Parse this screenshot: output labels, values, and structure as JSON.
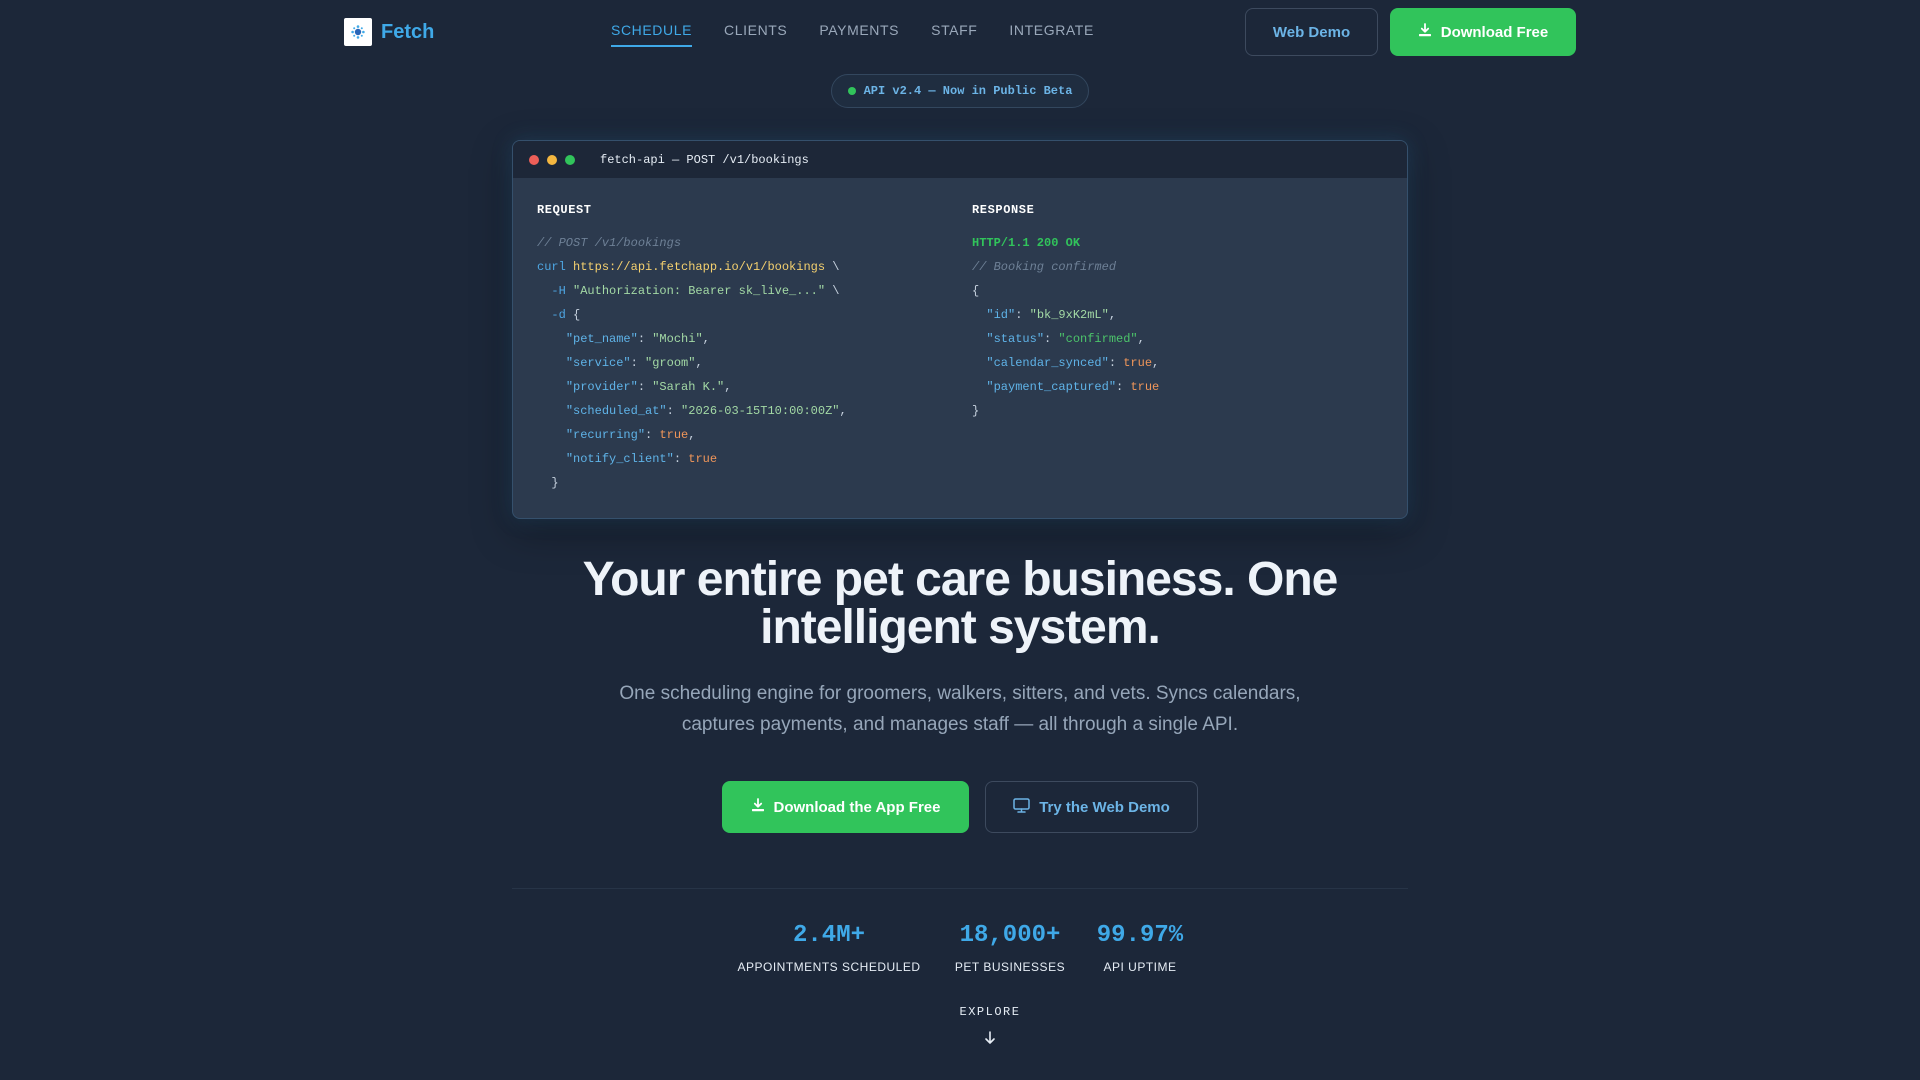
{
  "brand": {
    "name": "Fetch"
  },
  "nav": {
    "links": [
      {
        "label": "SCHEDULE",
        "active": true
      },
      {
        "label": "CLIENTS",
        "active": false
      },
      {
        "label": "PAYMENTS",
        "active": false
      },
      {
        "label": "STAFF",
        "active": false
      },
      {
        "label": "INTEGRATE",
        "active": false
      }
    ],
    "web_demo_label": "Web Demo",
    "download_label": "Download Free"
  },
  "badge": {
    "text": "API v2.4 — Now in Public Beta"
  },
  "terminal": {
    "title": "fetch-api — POST /v1/bookings",
    "request": {
      "heading": "REQUEST",
      "comment": "// POST /v1/bookings",
      "curl_cmd": "curl",
      "url": "https://api.fetchapp.io/v1/bookings",
      "header_flag": "-H",
      "header_value": "\"Authorization: Bearer sk_live_...\"",
      "data_flag": "-d",
      "fields": [
        {
          "key": "\"pet_name\"",
          "value": "\"Mochi\"",
          "type": "string"
        },
        {
          "key": "\"service\"",
          "value": "\"groom\"",
          "type": "string"
        },
        {
          "key": "\"provider\"",
          "value": "\"Sarah K.\"",
          "type": "string"
        },
        {
          "key": "\"scheduled_at\"",
          "value": "\"2026-03-15T10:00:00Z\"",
          "type": "string"
        },
        {
          "key": "\"recurring\"",
          "value": "true",
          "type": "bool"
        },
        {
          "key": "\"notify_client\"",
          "value": "true",
          "type": "bool"
        }
      ]
    },
    "response": {
      "heading": "RESPONSE",
      "status_line": "HTTP/1.1 200 OK",
      "comment": "// Booking confirmed",
      "fields": [
        {
          "key": "\"id\"",
          "value": "\"bk_9xK2mL\"",
          "type": "string"
        },
        {
          "key": "\"status\"",
          "value": "\"confirmed\"",
          "type": "status"
        },
        {
          "key": "\"calendar_synced\"",
          "value": "true",
          "type": "bool"
        },
        {
          "key": "\"payment_captured\"",
          "value": "true",
          "type": "bool"
        }
      ]
    }
  },
  "hero": {
    "title": "Your entire pet care business. One intelligent system.",
    "subtitle": "One scheduling engine for groomers, walkers, sitters, and vets. Syncs calendars, captures payments, and manages staff — all through a single API.",
    "cta_download": "Download the App Free",
    "cta_demo": "Try the Web Demo"
  },
  "stats": [
    {
      "value": "2.4M+",
      "label": "APPOINTMENTS SCHEDULED"
    },
    {
      "value": "18,000+",
      "label": "PET BUSINESSES"
    },
    {
      "value": "99.97%",
      "label": "API UPTIME"
    }
  ],
  "explore": {
    "label": "EXPLORE"
  },
  "colors": {
    "background": "#1c2739",
    "accent_blue": "#3fa9e8",
    "accent_green": "#31c45b",
    "terminal_red": "#ed5f58",
    "terminal_yellow": "#f4b740",
    "terminal_green": "#31c45b"
  },
  "icons": {
    "logo": "paw-logo-icon",
    "download": "download-icon",
    "monitor": "monitor-icon",
    "arrow": "arrow-down-icon"
  }
}
